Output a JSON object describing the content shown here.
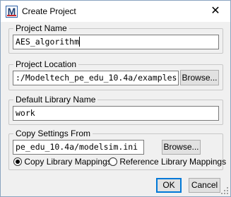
{
  "window": {
    "title": "Create Project",
    "app_icon_letter": "M",
    "close_glyph": "✕"
  },
  "project_name": {
    "label": "Project Name",
    "value": "AES_algorithm"
  },
  "project_location": {
    "label": "Project Location",
    "value": ":/Modeltech_pe_edu_10.4a/examples",
    "browse_label": "Browse..."
  },
  "default_library": {
    "label": "Default Library Name",
    "value": "work"
  },
  "copy_settings": {
    "label": "Copy Settings From",
    "value": "pe_edu_10.4a/modelsim.ini",
    "browse_label": "Browse...",
    "options": [
      {
        "label": "Copy Library Mappings",
        "checked": true
      },
      {
        "label": "Reference Library Mappings",
        "checked": false
      }
    ]
  },
  "footer": {
    "ok_label": "OK",
    "cancel_label": "Cancel"
  }
}
